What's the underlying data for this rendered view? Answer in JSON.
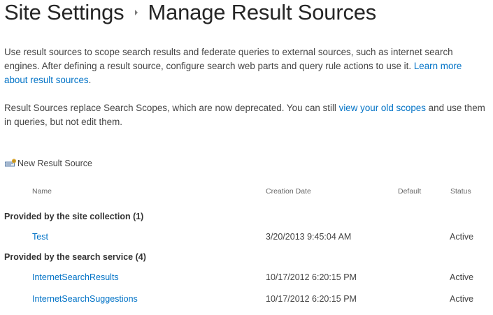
{
  "header": {
    "breadcrumb_root": "Site Settings",
    "page_title": "Manage Result Sources"
  },
  "intro": {
    "text": "Use result sources to scope search results and federate queries to external sources, such as internet search engines. After defining a result source, configure search web parts and query rule actions to use it.",
    "learn_more_link": "Learn more about result sources",
    "learn_more_suffix": "."
  },
  "deprecation": {
    "text_before": "Result Sources replace Search Scopes, which are now deprecated. You can still",
    "link": "view your old scopes",
    "text_after": "and use them in queries, but not edit them."
  },
  "toolbar": {
    "new_label": "New Result Source",
    "new_icon": "new-result-source-icon"
  },
  "table": {
    "columns": {
      "name": "Name",
      "creation_date": "Creation Date",
      "default": "Default",
      "status": "Status"
    },
    "groups": [
      {
        "label": "Provided by the site collection (1)",
        "rows": [
          {
            "name": "Test",
            "creation_date": "3/20/2013 9:45:04 AM",
            "default": "",
            "status": "Active"
          }
        ]
      },
      {
        "label": "Provided by the search service (4)",
        "rows": [
          {
            "name": "InternetSearchResults",
            "creation_date": "10/17/2012 6:20:15 PM",
            "default": "",
            "status": "Active"
          },
          {
            "name": "InternetSearchSuggestions",
            "creation_date": "10/17/2012 6:20:15 PM",
            "default": "",
            "status": "Active"
          }
        ]
      }
    ]
  },
  "colors": {
    "link": "#0072c6",
    "text": "#444444",
    "title": "#262626"
  }
}
